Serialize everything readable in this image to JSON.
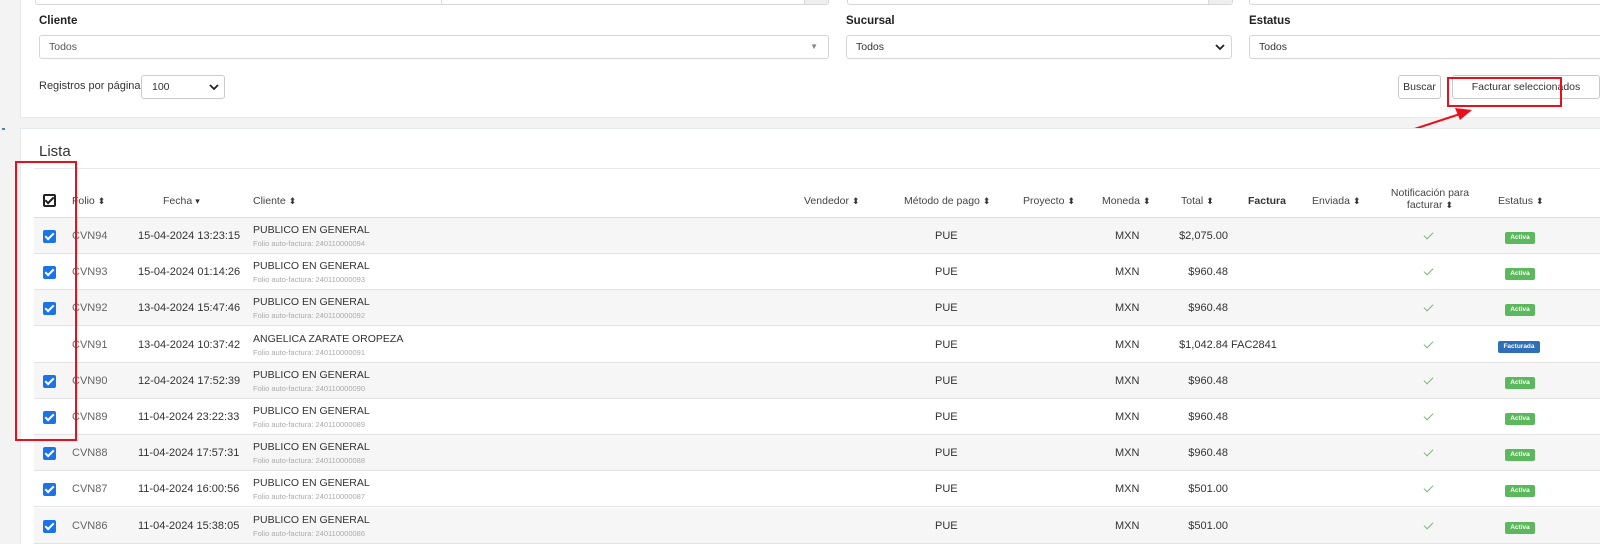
{
  "filters": {
    "cliente": {
      "label": "Cliente",
      "value": "Todos"
    },
    "sucursal": {
      "label": "Sucursal",
      "value": "Todos"
    },
    "estatus": {
      "label": "Estatus",
      "value": "Todos"
    },
    "registros_label": "Registros por página",
    "registros_value": "100"
  },
  "buttons": {
    "buscar": "Buscar",
    "facturar": "Facturar seleccionados"
  },
  "list": {
    "title": "Lista",
    "headers": {
      "folio": "Folio",
      "fecha": "Fecha",
      "cliente": "Cliente",
      "vendedor": "Vendedor",
      "metodo": "Método de pago",
      "proyecto": "Proyecto",
      "moneda": "Moneda",
      "total": "Total",
      "factura": "Factura",
      "enviada": "Enviada",
      "notificacion_1": "Notificación para",
      "notificacion_2": "facturar",
      "estatus": "Estatus"
    },
    "rows": [
      {
        "checked": true,
        "folio": "CVN94",
        "fecha": "15-04-2024 13:23:15",
        "cliente": "PUBLICO EN GENERAL",
        "sub": "Folio auto-factura: 240110000094",
        "metodo": "PUE",
        "moneda": "MXN",
        "total": "$2,075.00",
        "factura": "",
        "estatus": "Activa"
      },
      {
        "checked": true,
        "folio": "CVN93",
        "fecha": "15-04-2024 01:14:26",
        "cliente": "PUBLICO EN GENERAL",
        "sub": "Folio auto-factura: 240110000093",
        "metodo": "PUE",
        "moneda": "MXN",
        "total": "$960.48",
        "factura": "",
        "estatus": "Activa"
      },
      {
        "checked": true,
        "folio": "CVN92",
        "fecha": "13-04-2024 15:47:46",
        "cliente": "PUBLICO EN GENERAL",
        "sub": "Folio auto-factura: 240110000092",
        "metodo": "PUE",
        "moneda": "MXN",
        "total": "$960.48",
        "factura": "",
        "estatus": "Activa"
      },
      {
        "checked": false,
        "folio": "CVN91",
        "fecha": "13-04-2024 10:37:42",
        "cliente": "ANGELICA ZARATE OROPEZA",
        "sub": "Folio auto-factura: 240110000091",
        "metodo": "PUE",
        "moneda": "MXN",
        "total": "$1,042.84",
        "factura": "FAC2841",
        "estatus": "Facturada"
      },
      {
        "checked": true,
        "folio": "CVN90",
        "fecha": "12-04-2024 17:52:39",
        "cliente": "PUBLICO EN GENERAL",
        "sub": "Folio auto-factura: 240110000090",
        "metodo": "PUE",
        "moneda": "MXN",
        "total": "$960.48",
        "factura": "",
        "estatus": "Activa"
      },
      {
        "checked": true,
        "folio": "CVN89",
        "fecha": "11-04-2024 23:22:33",
        "cliente": "PUBLICO EN GENERAL",
        "sub": "Folio auto-factura: 240110000089",
        "metodo": "PUE",
        "moneda": "MXN",
        "total": "$960.48",
        "factura": "",
        "estatus": "Activa"
      },
      {
        "checked": true,
        "folio": "CVN88",
        "fecha": "11-04-2024 17:57:31",
        "cliente": "PUBLICO EN GENERAL",
        "sub": "Folio auto-factura: 240110000088",
        "metodo": "PUE",
        "moneda": "MXN",
        "total": "$960.48",
        "factura": "",
        "estatus": "Activa"
      },
      {
        "checked": true,
        "folio": "CVN87",
        "fecha": "11-04-2024 16:00:56",
        "cliente": "PUBLICO EN GENERAL",
        "sub": "Folio auto-factura: 240110000087",
        "metodo": "PUE",
        "moneda": "MXN",
        "total": "$501.00",
        "factura": "",
        "estatus": "Activa"
      },
      {
        "checked": true,
        "folio": "CVN86",
        "fecha": "11-04-2024 15:38:05",
        "cliente": "PUBLICO EN GENERAL",
        "sub": "Folio auto-factura: 240110000086",
        "metodo": "PUE",
        "moneda": "MXN",
        "total": "$501.00",
        "factura": "",
        "estatus": "Activa"
      }
    ]
  },
  "icons": {
    "sort": "sort-icon",
    "sort_desc": "caret-down-icon",
    "notification": "check-icon",
    "dropdown": "chevron-down-icon"
  },
  "colors": {
    "checkbox": "#1a73e8",
    "activa": "#5cb85c",
    "facturada": "#2f6fb7",
    "highlight": "#e8101a"
  }
}
